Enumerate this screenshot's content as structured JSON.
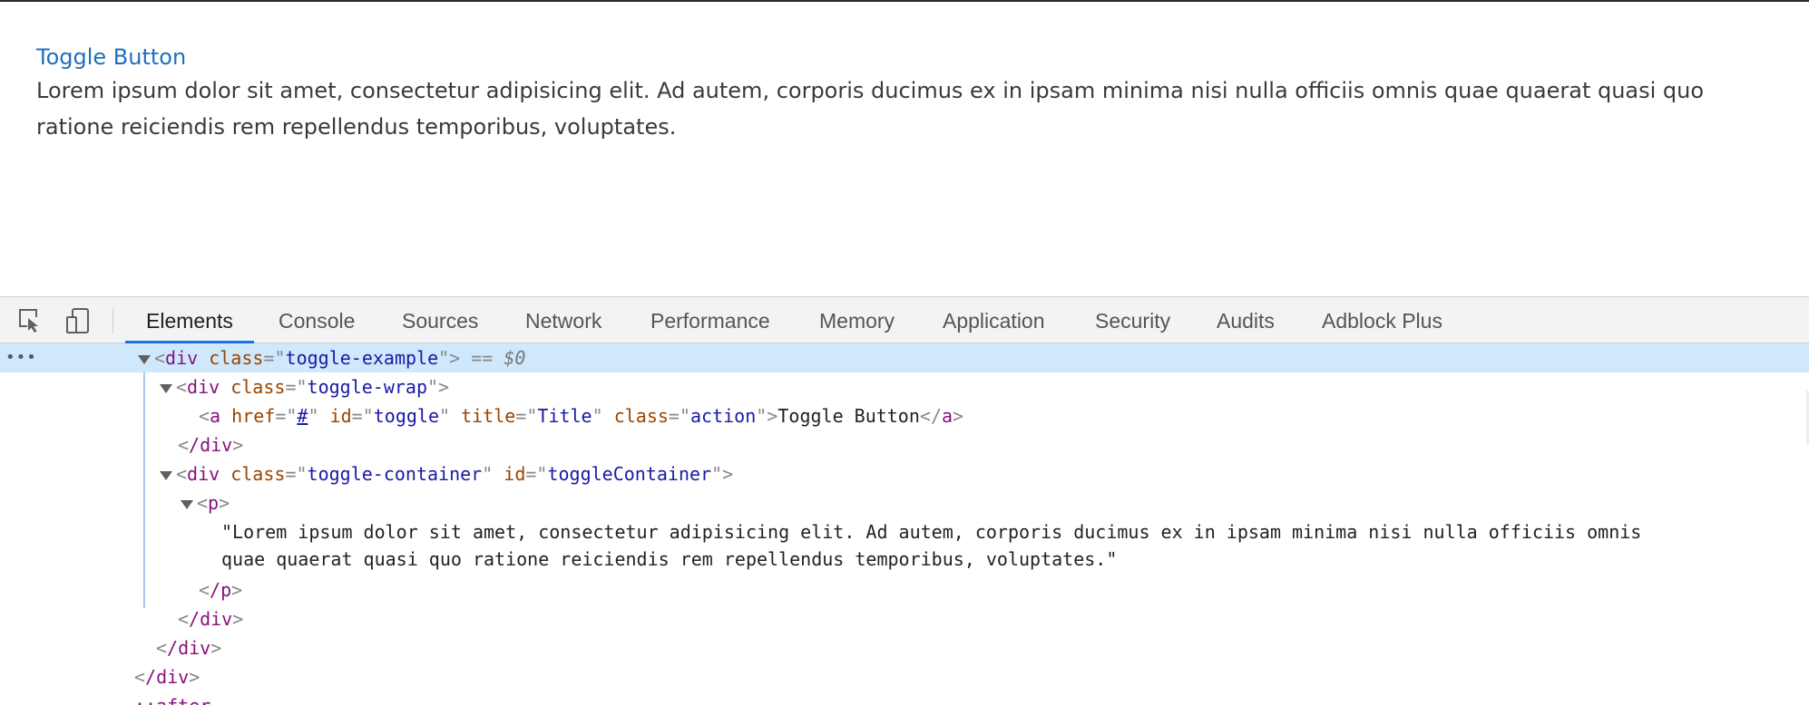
{
  "page": {
    "link_text": "Toggle Button",
    "paragraph": "Lorem ipsum dolor sit amet, consectetur adipisicing elit. Ad autem, corporis ducimus ex in ipsam minima nisi nulla officiis omnis quae quaerat quasi quo ratione reiciendis rem repellendus temporibus, voluptates."
  },
  "devtools": {
    "tabs": [
      {
        "label": "Elements",
        "active": true
      },
      {
        "label": "Console"
      },
      {
        "label": "Sources"
      },
      {
        "label": "Network"
      },
      {
        "label": "Performance"
      },
      {
        "label": "Memory"
      },
      {
        "label": "Application"
      },
      {
        "label": "Security"
      },
      {
        "label": "Audits"
      },
      {
        "label": "Adblock Plus"
      }
    ],
    "icons": {
      "inspect": "inspect-element-icon",
      "device": "device-toolbar-icon"
    },
    "tree": {
      "ellipsis": "•••",
      "row1": {
        "tag": "div",
        "attr": "class",
        "val": "toggle-example",
        "eq": " == ",
        "ref": "$0"
      },
      "row2": {
        "tag": "div",
        "attr": "class",
        "val": "toggle-wrap"
      },
      "row3": {
        "tag": "a",
        "href_attr": "href",
        "href_val": "#",
        "id_attr": "id",
        "id_val": "toggle",
        "title_attr": "title",
        "title_val": "Title",
        "class_attr": "class",
        "class_val": "action",
        "text": "Toggle Button"
      },
      "row4": {
        "close": "/div"
      },
      "row5": {
        "tag": "div",
        "attr1": "class",
        "val1": "toggle-container",
        "attr2": "id",
        "val2": "toggleContainer"
      },
      "row6": {
        "tag": "p"
      },
      "row7": {
        "text": "\"Lorem ipsum dolor sit amet, consectetur adipisicing elit. Ad autem, corporis ducimus ex in ipsam minima nisi nulla officiis omnis"
      },
      "row8": {
        "text": "quae quaerat quasi quo ratione reiciendis rem repellendus temporibus, voluptates.\""
      },
      "row9": {
        "close": "/p"
      },
      "row10": {
        "close": "/div"
      },
      "row11": {
        "close": "/div"
      },
      "row12": {
        "close": "/div"
      },
      "row13": {
        "text": "::after"
      }
    },
    "colors": {
      "accent": "#1a73e8",
      "selection": "#cfe8fc",
      "tag": "#881280",
      "attr": "#994500",
      "value": "#1a1aa6"
    }
  }
}
